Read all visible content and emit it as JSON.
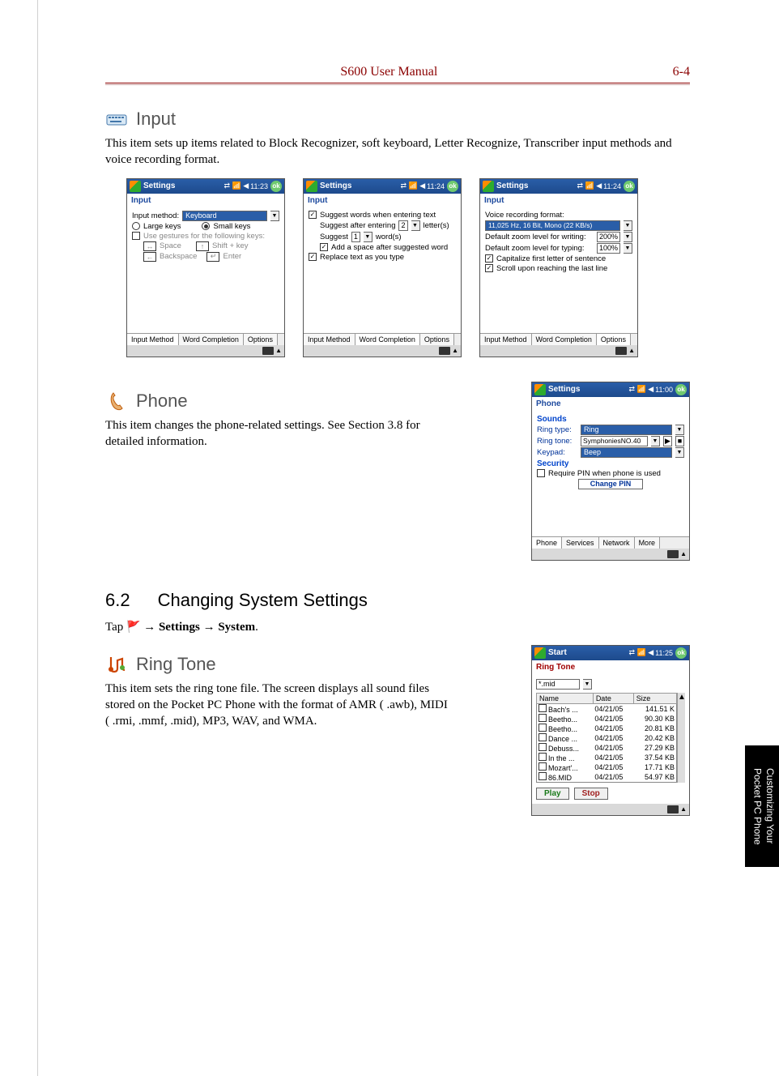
{
  "header": {
    "title": "S600 User Manual",
    "page": "6-4"
  },
  "input": {
    "heading": "Input",
    "desc": "This item sets up items related to Block Recognizer, soft keyboard, Letter Recognize, Transcriber input methods and voice recording format.",
    "tabs": [
      "Input Method",
      "Word Completion",
      "Options"
    ],
    "shot1": {
      "title": "Settings",
      "time": "11:23",
      "sub": "Input",
      "row_method_label": "Input method:",
      "row_method_value": "Keyboard",
      "large_keys": "Large keys",
      "small_keys": "Small keys",
      "gestures": "Use gestures for the following keys:",
      "space": "Space",
      "shift": "Shift + key",
      "backspace": "Backspace",
      "enter": "Enter"
    },
    "shot2": {
      "title": "Settings",
      "time": "11:24",
      "sub": "Input",
      "l1": "Suggest words when entering text",
      "l2a": "Suggest after entering",
      "l2b": "2",
      "l2c": "letter(s)",
      "l3a": "Suggest",
      "l3b": "1",
      "l3c": "word(s)",
      "l4": "Add a space after suggested word",
      "l5": "Replace text as you type"
    },
    "shot3": {
      "title": "Settings",
      "time": "11:24",
      "sub": "Input",
      "v_label": "Voice recording format:",
      "v_value": "11,025 Hz, 16 Bit, Mono (22 KB/s)",
      "zw_label": "Default zoom level for writing:",
      "zw_val": "200%",
      "zt_label": "Default zoom level for typing:",
      "zt_val": "100%",
      "cap": "Capitalize first letter of sentence",
      "scroll": "Scroll upon reaching the last line"
    }
  },
  "phone": {
    "heading": "Phone",
    "desc": "This item changes the phone-related settings. See Section 3.8 for detailed information.",
    "shot": {
      "title": "Settings",
      "time": "11:00",
      "sub": "Phone",
      "sounds": "Sounds",
      "ring_type_l": "Ring type:",
      "ring_type_v": "Ring",
      "ring_tone_l": "Ring tone:",
      "ring_tone_v": "SymphoniesNO.40",
      "keypad_l": "Keypad:",
      "keypad_v": "Beep",
      "security": "Security",
      "require_pin": "Require PIN when phone is used",
      "change_pin": "Change PIN",
      "tabs": [
        "Phone",
        "Services",
        "Network",
        "More"
      ]
    }
  },
  "sys": {
    "num": "6.2",
    "title": "Changing System Settings",
    "tap": "Tap ",
    "arrow": " → ",
    "settings": "Settings",
    "system": "System",
    "period": "."
  },
  "ringtone": {
    "heading": "Ring Tone",
    "desc": "This item sets the ring tone file. The screen displays all sound files stored on the Pocket PC Phone with the format of AMR ( .awb), MIDI ( .rmi, .mmf, .mid), MP3, WAV, and WMA.",
    "shot": {
      "title": "Start",
      "time": "11:25",
      "sub": "Ring Tone",
      "filter": "*.mid",
      "cols": [
        "Name",
        "Date",
        "Size"
      ],
      "rows": [
        [
          "Bach's ...",
          "04/21/05",
          "141.51 K"
        ],
        [
          "Beetho...",
          "04/21/05",
          "90.30 KB"
        ],
        [
          "Beetho...",
          "04/21/05",
          "20.81 KB"
        ],
        [
          "Dance ...",
          "04/21/05",
          "20.42 KB"
        ],
        [
          "Debuss...",
          "04/21/05",
          "27.29 KB"
        ],
        [
          "In the ...",
          "04/21/05",
          "37.54 KB"
        ],
        [
          "Mozart'...",
          "04/21/05",
          "17.71 KB"
        ],
        [
          "86.MID",
          "04/21/05",
          "54.97 KB"
        ]
      ],
      "play": "Play",
      "stop": "Stop"
    }
  },
  "sidetab": {
    "l1": "Customizing Your",
    "l2": "Pocket PC Phone"
  }
}
